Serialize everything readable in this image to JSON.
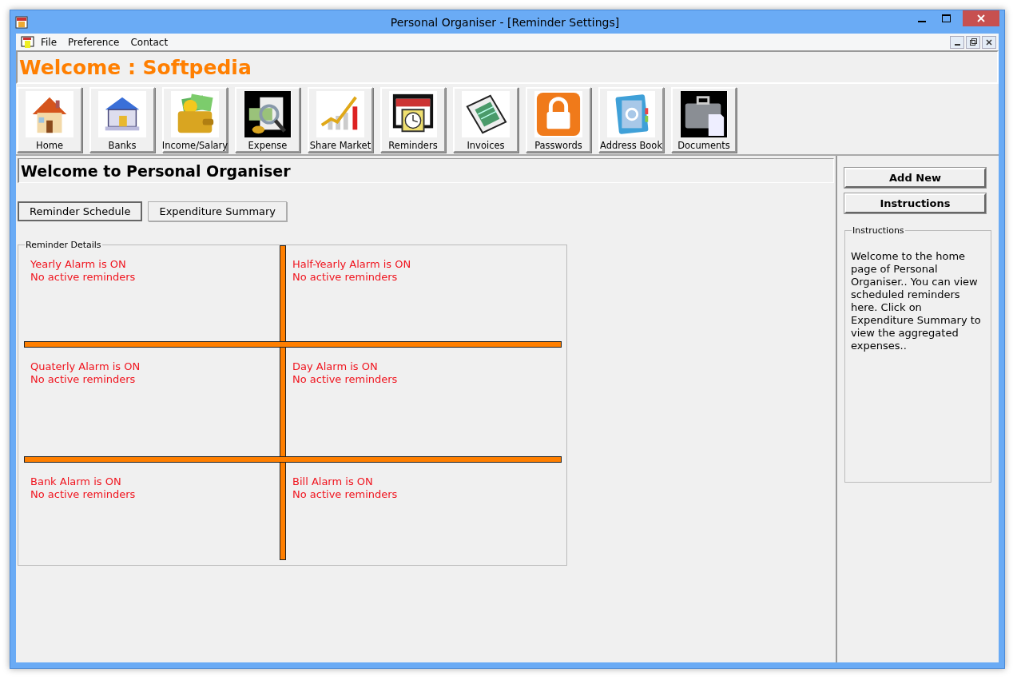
{
  "window": {
    "title": "Personal Organiser - [Reminder Settings]"
  },
  "menu": [
    {
      "label": "File"
    },
    {
      "label": "Preference"
    },
    {
      "label": "Contact"
    }
  ],
  "header": "Welcome : Softpedia",
  "toolbar": [
    {
      "label": "Home"
    },
    {
      "label": "Banks"
    },
    {
      "label": "Income/Salary"
    },
    {
      "label": "Expense"
    },
    {
      "label": "Share Market"
    },
    {
      "label": "Reminders"
    },
    {
      "label": "Invoices"
    },
    {
      "label": "Passwords"
    },
    {
      "label": "Address Book"
    },
    {
      "label": "Documents"
    }
  ],
  "page_title": "Welcome to Personal Organiser",
  "tabs": [
    {
      "label": "Reminder Schedule",
      "selected": true
    },
    {
      "label": "Expenditure Summary",
      "selected": false
    }
  ],
  "reminder_details": {
    "title": "Reminder Details",
    "cells": [
      {
        "alarm": "Yearly Alarm is ON",
        "status": "No active reminders"
      },
      {
        "alarm": "Half-Yearly Alarm is ON",
        "status": "No active reminders"
      },
      {
        "alarm": "Quaterly Alarm is ON",
        "status": "No active reminders"
      },
      {
        "alarm": "Day Alarm is ON",
        "status": "No active reminders"
      },
      {
        "alarm": "Bank Alarm is ON",
        "status": "No active reminders"
      },
      {
        "alarm": "Bill Alarm is ON",
        "status": "No active reminders"
      }
    ]
  },
  "side": {
    "buttons": [
      {
        "label": "Add New"
      },
      {
        "label": "Instructions"
      }
    ],
    "instructions": {
      "title": "Instructions",
      "text": "Welcome to the home page of Personal Organiser.. You can view scheduled reminders here. Click on Expenditure Summary to view the aggregated expenses.."
    }
  }
}
